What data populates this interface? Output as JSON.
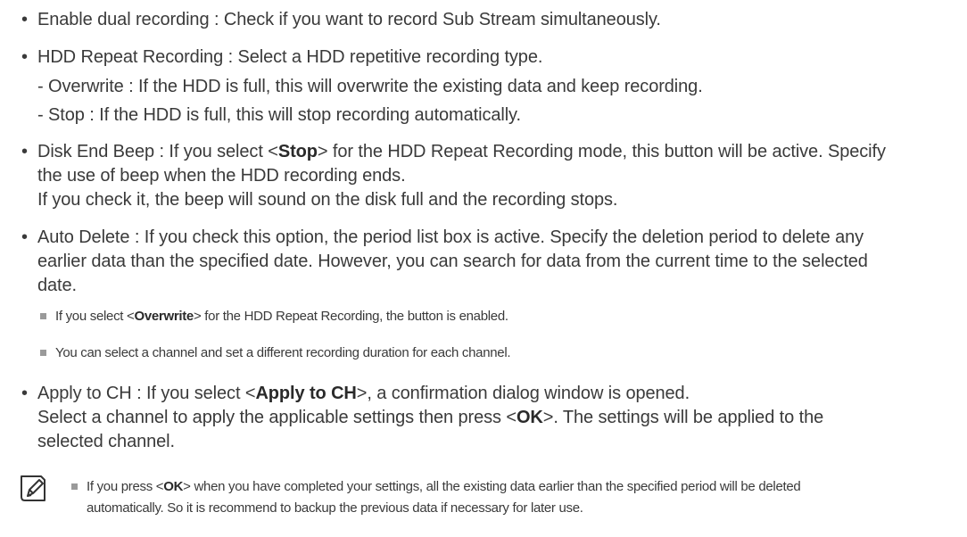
{
  "items": [
    {
      "term": "Enable dual recording",
      "desc": "Check if you want to record Sub Stream simultaneously."
    },
    {
      "term": "HDD Repeat Recording",
      "desc": "Select a HDD repetitive recording type."
    },
    {
      "sub1": "- Overwrite : If the HDD is full, this will overwrite the existing data and keep recording."
    },
    {
      "sub2": "- Stop : If the HDD is full, this will stop recording automatically."
    }
  ],
  "disk_end_beep": {
    "line1_a": "Disk End Beep : If you select <",
    "line1_b": "Stop",
    "line1_c": "> for the HDD Repeat Recording mode, this button will be active. Specify",
    "line2": "the use of beep when the HDD recording ends.",
    "line3": "If you check it, the beep will sound on the disk full and the recording stops."
  },
  "auto_delete": {
    "line1": "Auto Delete : If you check this option, the period list box is active. Specify the deletion period to delete any",
    "line2": "earlier data than the specified date. However, you can search for data from the current time to the selected",
    "line3": "date.",
    "note1_a": "If you select <",
    "note1_b": "Overwrite",
    "note1_c": "> for the HDD Repeat Recording, the button is enabled.",
    "note2": "You can select a channel and set a different recording duration for each channel."
  },
  "apply_ch": {
    "line1_a": "Apply to CH : If you select <",
    "line1_b": "Apply to CH",
    "line1_c": ">, a confirmation dialog window is opened.",
    "line2_a": "Select a channel to apply the applicable settings then press <",
    "line2_b": "OK",
    "line2_c": ">. The settings will be applied to the",
    "line3": "selected channel."
  },
  "note": {
    "icon": "note-pencil-icon",
    "line1_a": "If you press <",
    "line1_b": "OK",
    "line1_c": "> when you have completed your settings, all the existing data earlier than the specified period will be deleted",
    "line2": "automatically. So it is recommend to backup the previous data if necessary for later use."
  }
}
